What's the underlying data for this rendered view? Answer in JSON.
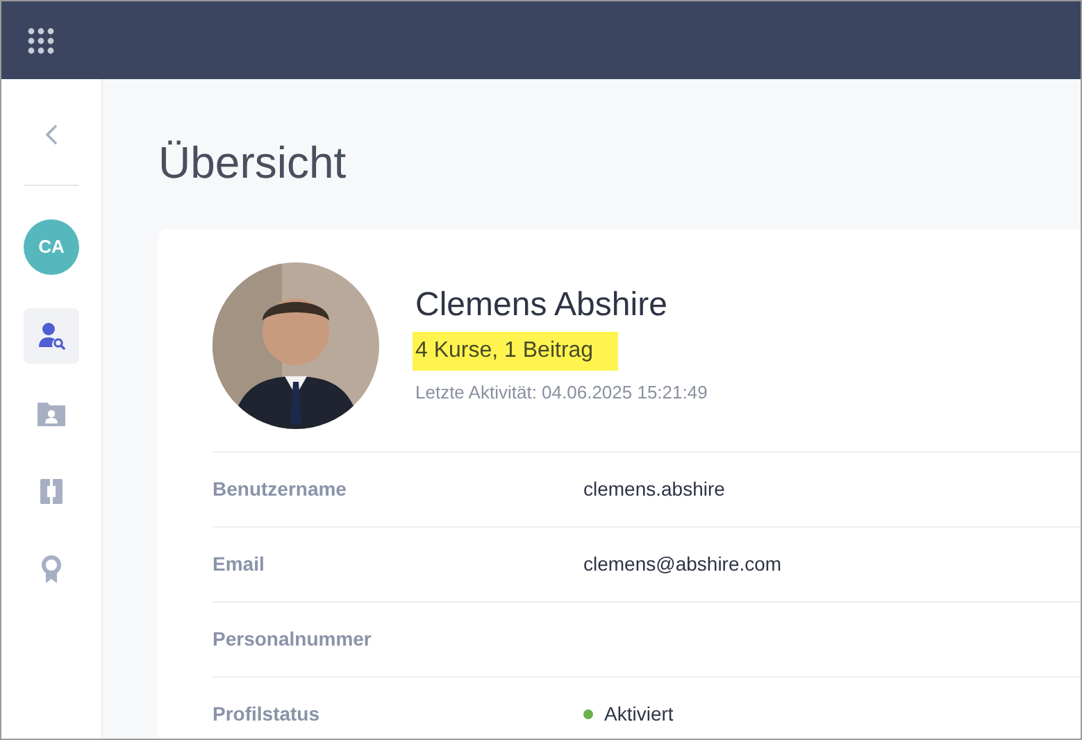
{
  "sidebar": {
    "avatar_initials": "CA",
    "items": [
      {
        "kind": "person-search",
        "selected": true
      },
      {
        "kind": "folder-person",
        "selected": false
      },
      {
        "kind": "bracket",
        "selected": false
      },
      {
        "kind": "award",
        "selected": false
      }
    ]
  },
  "page_title": "Übersicht",
  "profile": {
    "name": "Clemens Abshire",
    "summary": {
      "text": "4 Kurse, 1 Beitrag",
      "highlighted": true
    },
    "last_activity": "Letzte Aktivität: 04.06.2025 15:21:49"
  },
  "fields": [
    {
      "label": "Benutzername",
      "value": "clemens.abshire"
    },
    {
      "label": "Email",
      "value": "clemens@abshire.com"
    },
    {
      "label": "Personalnummer"
    },
    {
      "label": "Profilstatus",
      "value": "Aktiviert",
      "color": "#6ab04c"
    }
  ]
}
